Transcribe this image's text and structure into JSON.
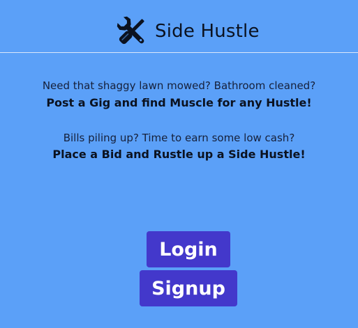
{
  "header": {
    "logo_icon": "wrench-screwdriver-icon",
    "title": "Side Hustle"
  },
  "hero": {
    "line1": "Need that shaggy lawn mowed? Bathroom cleaned?",
    "line2": "Post a Gig and find Muscle for any Hustle!",
    "line3": "Bills piling up? Time to earn some low cash?",
    "line4": "Place a Bid and Rustle up a Side Hustle!"
  },
  "buttons": {
    "login_label": "Login",
    "signup_label": "Signup"
  },
  "colors": {
    "background": "#5ba0f8",
    "button": "#4338cb",
    "button_text": "#ffffff"
  }
}
